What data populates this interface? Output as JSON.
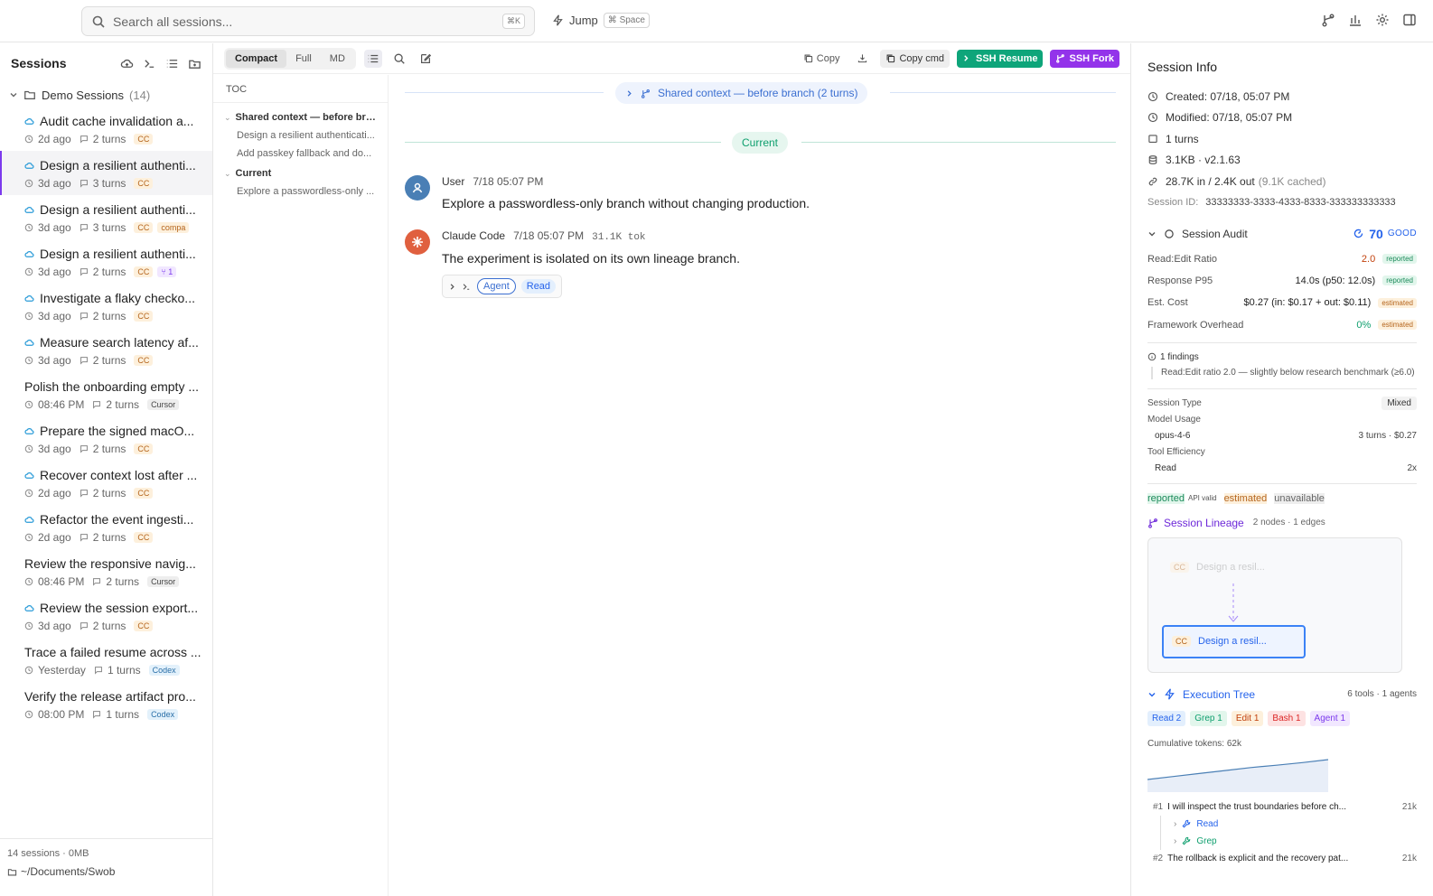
{
  "topbar": {
    "search_placeholder": "Search all sessions...",
    "search_kbd": "⌘K",
    "jump_label": "Jump",
    "jump_kbd": "⌘ Space",
    "icons": [
      "branch-icon",
      "chart-icon",
      "gear-icon",
      "panel-icon"
    ]
  },
  "sidebar": {
    "title": "Sessions",
    "group": {
      "label": "Demo Sessions",
      "count": "(14)"
    },
    "sessions": [
      {
        "title": "Audit cache invalidation a...",
        "cloud": true,
        "time": "2d ago",
        "turns": "2 turns",
        "tag": "CC",
        "tag_kind": "cc",
        "active": false
      },
      {
        "title": "Design a resilient authenti...",
        "cloud": true,
        "time": "3d ago",
        "turns": "3 turns",
        "tag": "CC",
        "tag_kind": "cc",
        "active": true
      },
      {
        "title": "Design a resilient authenti...",
        "cloud": true,
        "time": "3d ago",
        "turns": "3 turns",
        "tag": "CC",
        "tag_kind": "cc",
        "tag2": "compa",
        "tag2_kind": "compa",
        "active": false
      },
      {
        "title": "Design a resilient authenti...",
        "cloud": true,
        "time": "3d ago",
        "turns": "2 turns",
        "tag": "CC",
        "tag_kind": "cc",
        "tag2": "1",
        "tag2_kind": "branch",
        "active": false
      },
      {
        "title": "Investigate a flaky checko...",
        "cloud": true,
        "time": "3d ago",
        "turns": "2 turns",
        "tag": "CC",
        "tag_kind": "cc",
        "active": false
      },
      {
        "title": "Measure search latency af...",
        "cloud": true,
        "time": "3d ago",
        "turns": "2 turns",
        "tag": "CC",
        "tag_kind": "cc",
        "active": false
      },
      {
        "title": "Polish the onboarding empty ...",
        "cloud": false,
        "time": "08:46 PM",
        "turns": "2 turns",
        "tag": "Cursor",
        "tag_kind": "cursor",
        "active": false
      },
      {
        "title": "Prepare the signed macO...",
        "cloud": true,
        "time": "3d ago",
        "turns": "2 turns",
        "tag": "CC",
        "tag_kind": "cc",
        "active": false
      },
      {
        "title": "Recover context lost after ...",
        "cloud": true,
        "time": "2d ago",
        "turns": "2 turns",
        "tag": "CC",
        "tag_kind": "cc",
        "active": false
      },
      {
        "title": "Refactor the event ingesti...",
        "cloud": true,
        "time": "2d ago",
        "turns": "2 turns",
        "tag": "CC",
        "tag_kind": "cc",
        "active": false
      },
      {
        "title": "Review the responsive navig...",
        "cloud": false,
        "time": "08:46 PM",
        "turns": "2 turns",
        "tag": "Cursor",
        "tag_kind": "cursor",
        "active": false
      },
      {
        "title": "Review the session export...",
        "cloud": true,
        "time": "3d ago",
        "turns": "2 turns",
        "tag": "CC",
        "tag_kind": "cc",
        "active": false
      },
      {
        "title": "Trace a failed resume across ...",
        "cloud": false,
        "time": "Yesterday",
        "turns": "1 turns",
        "tag": "Codex",
        "tag_kind": "codex",
        "active": false
      },
      {
        "title": "Verify the release artifact pro...",
        "cloud": false,
        "time": "08:00 PM",
        "turns": "1 turns",
        "tag": "Codex",
        "tag_kind": "codex",
        "active": false
      }
    ],
    "footer_count": "14 sessions · 0MB",
    "footer_path": "~/Documents/Swob"
  },
  "toolbar": {
    "modes": [
      "Compact",
      "Full",
      "MD"
    ],
    "active_mode": "Compact",
    "copy": "Copy",
    "copy_cmd": "Copy cmd",
    "ssh_resume": "SSH Resume",
    "ssh_fork": "SSH Fork"
  },
  "toc": {
    "header": "TOC",
    "sections": [
      {
        "title": "Shared context — before bra...",
        "items": [
          "Design a resilient authenticati...",
          "Add passkey fallback and do..."
        ]
      },
      {
        "title": "Current",
        "items": [
          "Explore a passwordless-only ..."
        ]
      }
    ]
  },
  "conversation": {
    "shared_pill": "Shared context — before branch (2 turns)",
    "current_pill": "Current",
    "messages": [
      {
        "who": "User",
        "time": "7/18 05:07 PM",
        "tokens": "",
        "body": "Explore a passwordless-only branch without changing production."
      },
      {
        "who": "Claude Code",
        "time": "7/18 05:07 PM",
        "tokens": "31.1K tok",
        "body": "The experiment is isolated on its own lineage branch.",
        "tools": [
          "Agent",
          "Read"
        ]
      }
    ]
  },
  "info": {
    "title": "Session Info",
    "created": "Created: 07/18, 05:07 PM",
    "modified": "Modified: 07/18, 05:07 PM",
    "turns": "1 turns",
    "size": "3.1KB · v2.1.63",
    "tokens": "28.7K in / 2.4K out",
    "cached": "(9.1K cached)",
    "session_id_label": "Session ID:",
    "session_id": "33333333-3333-4333-8333-333333333333",
    "audit": {
      "title": "Session Audit",
      "score": "70",
      "grade": "GOOD",
      "metrics": [
        {
          "label": "Read:Edit Ratio",
          "value": "2.0",
          "badge": "reported",
          "color": "#c2410c"
        },
        {
          "label": "Response P95",
          "value": "14.0s (p50: 12.0s)",
          "badge": "reported",
          "color": "#222"
        },
        {
          "label": "Est. Cost",
          "value": "$0.27 (in: $0.17 + out: $0.11)",
          "badge": "estimated",
          "color": "#222"
        },
        {
          "label": "Framework Overhead",
          "value": "0%",
          "badge": "estimated",
          "color": "#0e9f6e"
        }
      ],
      "findings_title": "1 findings",
      "finding": "Read:Edit ratio 2.0 — slightly below research benchmark (≥6.0)",
      "session_type_label": "Session Type",
      "session_type": "Mixed",
      "model_usage_label": "Model Usage",
      "model": "opus-4-6",
      "model_stats": "3 turns · $0.27",
      "tool_eff_label": "Tool Efficiency",
      "tool": "Read",
      "tool_count": "2x",
      "legend": {
        "reported": "reported",
        "reported_desc": "API valid",
        "estimated": "estimated",
        "unavailable": "unavailable"
      }
    },
    "lineage": {
      "title": "Session Lineage",
      "stats": "2 nodes · 1 edges",
      "parent_tag": "CC",
      "parent_label": "Design a resil...",
      "child_tag": "CC",
      "child_label": "Design a resil..."
    },
    "exec": {
      "title": "Execution Tree",
      "stats": "6 tools · 1 agents",
      "tools": [
        {
          "label": "Read 2",
          "bg": "#e3effd",
          "fg": "#2563eb"
        },
        {
          "label": "Grep 1",
          "bg": "#e2f6ec",
          "fg": "#0e9f6e"
        },
        {
          "label": "Edit 1",
          "bg": "#fdf0dc",
          "fg": "#c2410c"
        },
        {
          "label": "Bash 1",
          "bg": "#fde2e2",
          "fg": "#dc2626"
        },
        {
          "label": "Agent 1",
          "bg": "#f1e7ff",
          "fg": "#7c3aed"
        }
      ],
      "cumulative": "Cumulative tokens: 62k",
      "spark": [
        0.0,
        0.15,
        0.3,
        0.45,
        0.6,
        0.72,
        0.85,
        1.0
      ],
      "rows": [
        {
          "n": "#1",
          "text": "I will inspect the trust boundaries before ch...",
          "k": "21k",
          "subs": [
            "Read",
            "Grep"
          ]
        },
        {
          "n": "#2",
          "text": "The rollback is explicit and the recovery pat...",
          "k": "21k",
          "subs": []
        }
      ]
    }
  }
}
